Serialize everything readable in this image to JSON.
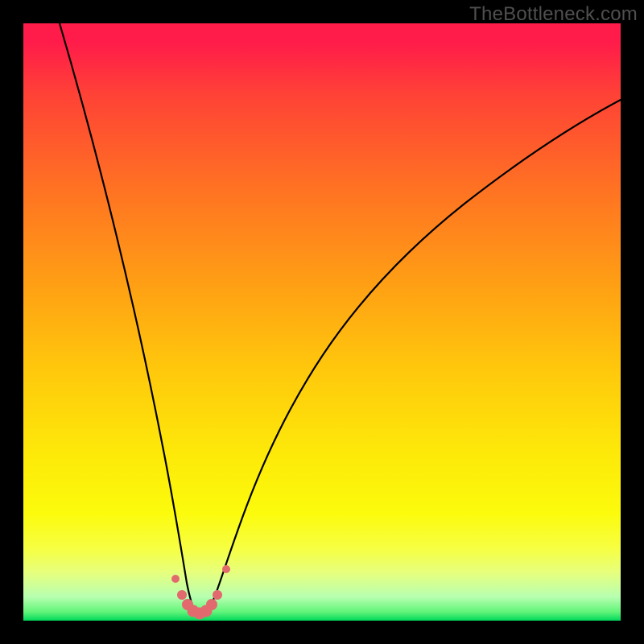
{
  "watermark": "TheBottleneck.com",
  "colors": {
    "gradient_top": "#ff1b4a",
    "gradient_bottom": "#00d85a",
    "curve_stroke": "#000000",
    "dot_fill": "#e26a6f",
    "frame_bg": "#000000"
  },
  "chart_data": {
    "type": "line",
    "title": "",
    "xlabel": "",
    "ylabel": "",
    "xlim": [
      0,
      100
    ],
    "ylim": [
      0,
      100
    ],
    "grid": false,
    "legend": false,
    "series": [
      {
        "name": "bottleneck-curve",
        "x": [
          6,
          10,
          14,
          18,
          22,
          24,
          26,
          27,
          28,
          29,
          30,
          31,
          32,
          33,
          35,
          38,
          42,
          48,
          55,
          63,
          72,
          82,
          92,
          100
        ],
        "y": [
          100,
          84,
          67,
          50,
          32,
          22,
          12,
          7,
          4,
          2,
          1,
          2,
          4,
          7,
          14,
          25,
          38,
          52,
          63,
          71,
          78,
          83,
          87,
          90
        ]
      }
    ],
    "highlighted_points": {
      "x": [
        25.5,
        26.5,
        27.5,
        28.5,
        29.5,
        30.5,
        31.5,
        32.5,
        34.0
      ],
      "y": [
        7,
        4,
        2.5,
        1.5,
        1.2,
        1.5,
        2.5,
        4,
        9
      ],
      "radius": [
        5,
        6,
        7,
        7.5,
        7.5,
        7.5,
        7,
        6,
        5
      ]
    }
  }
}
